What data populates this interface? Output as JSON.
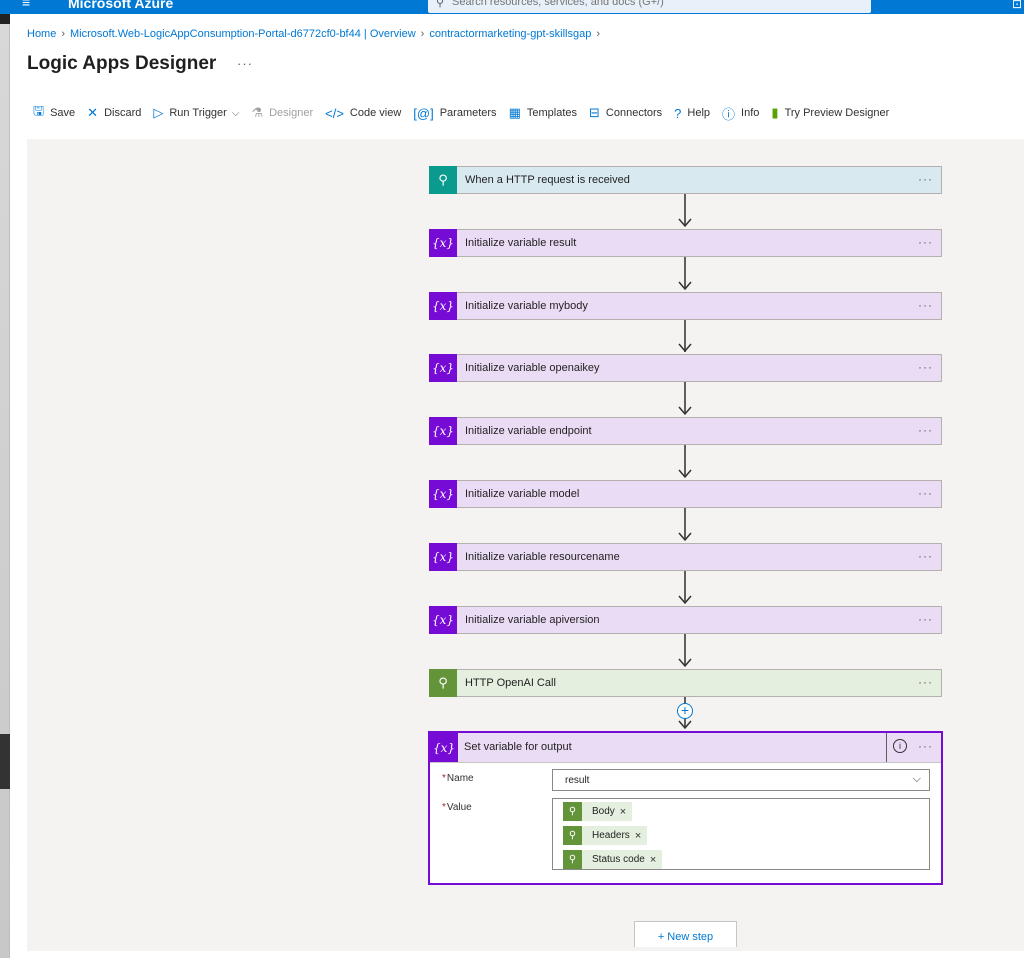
{
  "topbar": {
    "brand": "Microsoft Azure",
    "search_placeholder": "Search resources, services, and docs (G+/)"
  },
  "breadcrumb": {
    "items": [
      "Home",
      "Microsoft.Web-LogicAppConsumption-Portal-d6772cf0-bf44 | Overview",
      "contractormarketing-gpt-skillsgap"
    ]
  },
  "page": {
    "title": "Logic Apps Designer",
    "more": "···"
  },
  "toolbar": {
    "save": "Save",
    "discard": "Discard",
    "run_trigger": "Run Trigger",
    "designer": "Designer",
    "code_view": "Code view",
    "parameters": "Parameters",
    "templates": "Templates",
    "connectors": "Connectors",
    "help": "Help",
    "info": "Info",
    "try_preview": "Try Preview Designer"
  },
  "steps": [
    {
      "label": "When a HTTP request is received",
      "kind": "http-trigger"
    },
    {
      "label": "Initialize variable result",
      "kind": "var"
    },
    {
      "label": "Initialize variable mybody",
      "kind": "var"
    },
    {
      "label": "Initialize variable openaikey",
      "kind": "var"
    },
    {
      "label": "Initialize variable endpoint",
      "kind": "var"
    },
    {
      "label": "Initialize variable model",
      "kind": "var"
    },
    {
      "label": "Initialize variable resourcename",
      "kind": "var"
    },
    {
      "label": "Initialize variable apiversion",
      "kind": "var"
    },
    {
      "label": "HTTP OpenAI Call",
      "kind": "http"
    }
  ],
  "card_more": "···",
  "badge_var": "{x}",
  "expanded": {
    "title": "Set variable for output",
    "name_label": "Name",
    "name_value": "result",
    "value_label": "Value",
    "required_mark": "*",
    "tokens": [
      "Body",
      "Headers",
      "Status code"
    ],
    "token_remove": "×"
  },
  "new_step": "+ New step",
  "colors": {
    "azure_blue": "#0078d4",
    "variable_purple": "#770bd6",
    "http_green": "#64943a",
    "trigger_teal": "#0b9a8e"
  }
}
